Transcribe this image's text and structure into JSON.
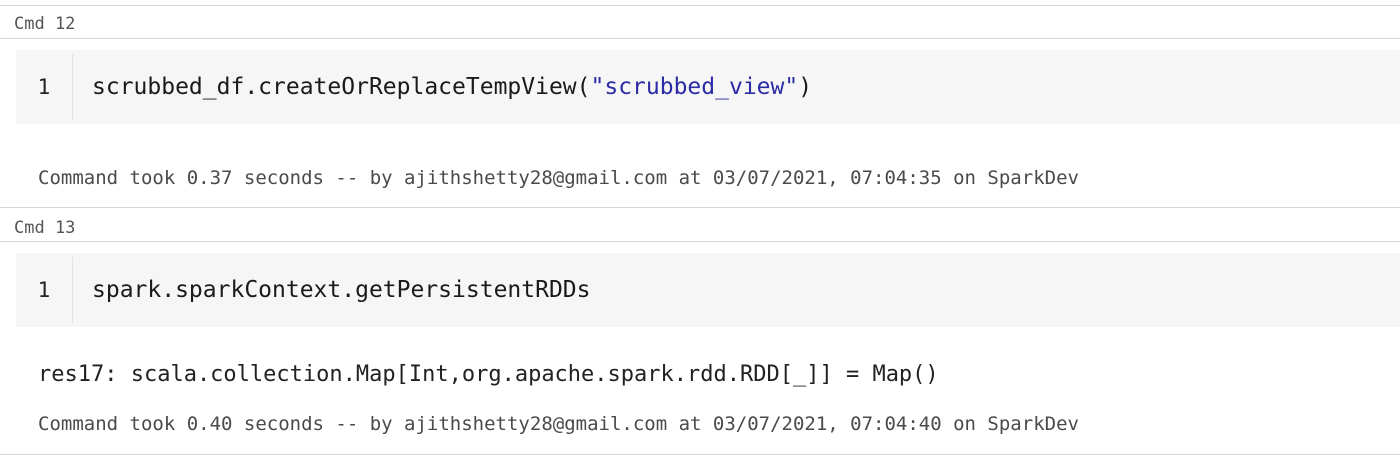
{
  "cells": [
    {
      "label": "Cmd 12",
      "line_number": "1",
      "code_prefix": "scrubbed_df.createOrReplaceTempView(",
      "code_string": "\"scrubbed_view\"",
      "code_suffix": ")",
      "result": "",
      "status": "Command took 0.37 seconds -- by ajithshetty28@gmail.com at 03/07/2021, 07:04:35 on SparkDev"
    },
    {
      "label": "Cmd 13",
      "line_number": "1",
      "code_prefix": "spark.sparkContext.getPersistentRDDs",
      "code_string": "",
      "code_suffix": "",
      "result": "res17: scala.collection.Map[Int,org.apache.spark.rdd.RDD[_]] = Map()",
      "status": "Command took 0.40 seconds -- by ajithshetty28@gmail.com at 03/07/2021, 07:04:40 on SparkDev"
    }
  ]
}
